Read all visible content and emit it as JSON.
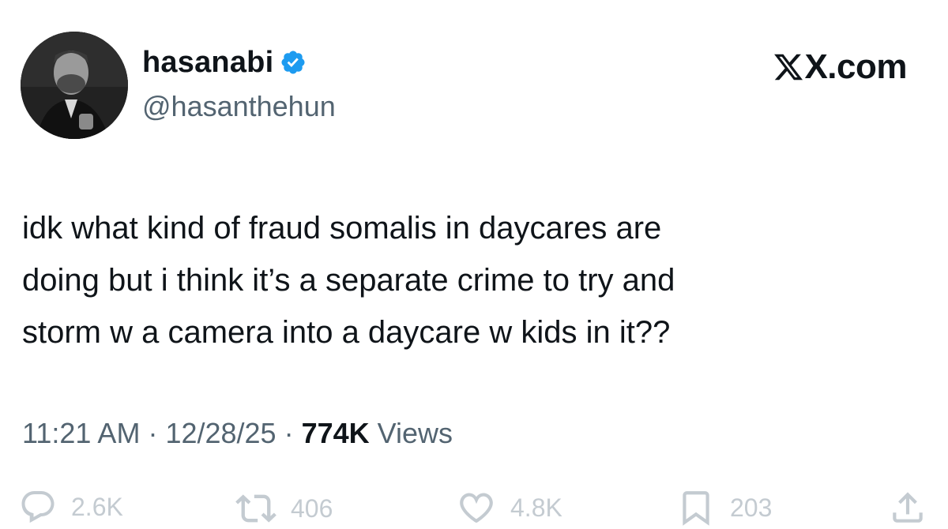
{
  "author": {
    "display_name": "hasanabi",
    "handle": "@hasanthehun",
    "verified": true
  },
  "brand": {
    "domain_label": "X.com",
    "verified_color": "#1d9bf0"
  },
  "tweet": {
    "lines": [
      "idk what kind of fraud somalis in daycares are",
      "doing but i think it’s a separate crime to try and",
      "storm w a camera into a daycare w kids in it??"
    ]
  },
  "meta": {
    "time": "11:21 AM",
    "date": "12/28/25",
    "views_count": "774K",
    "views_label": "Views",
    "separator": "·"
  },
  "actions": {
    "replies": "2.6K",
    "reposts": "406",
    "likes": "4.8K",
    "bookmarks": "203"
  }
}
